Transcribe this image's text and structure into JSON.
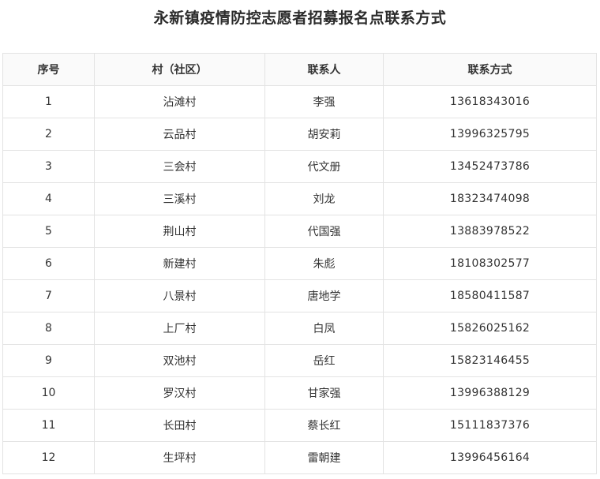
{
  "title": "永新镇疫情防控志愿者招募报名点联系方式",
  "table": {
    "headers": [
      "序号",
      "村（社区）",
      "联系人",
      "联系方式"
    ],
    "rows": [
      [
        "1",
        "沾滩村",
        "李强",
        "13618343016"
      ],
      [
        "2",
        "云品村",
        "胡安莉",
        "13996325795"
      ],
      [
        "3",
        "三会村",
        "代文册",
        "13452473786"
      ],
      [
        "4",
        "三溪村",
        "刘龙",
        "18323474098"
      ],
      [
        "5",
        "荆山村",
        "代国强",
        "13883978522"
      ],
      [
        "6",
        "新建村",
        "朱彪",
        "18108302577"
      ],
      [
        "7",
        "八景村",
        "唐地学",
        "18580411587"
      ],
      [
        "8",
        "上厂村",
        "白凤",
        "15826025162"
      ],
      [
        "9",
        "双池村",
        "岳红",
        "15823146455"
      ],
      [
        "10",
        "罗汉村",
        "甘家强",
        "13996388129"
      ],
      [
        "11",
        "长田村",
        "蔡长红",
        "15111837376"
      ],
      [
        "12",
        "生坪村",
        "雷朝建",
        "13996456164"
      ]
    ]
  }
}
